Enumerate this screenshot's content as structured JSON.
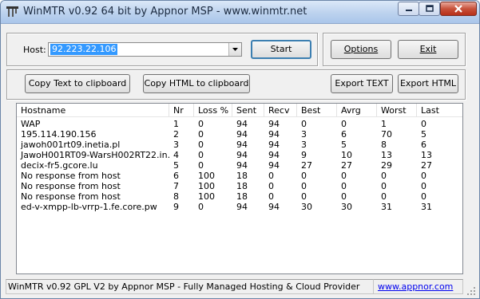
{
  "window": {
    "title": "WinMTR v0.92 64 bit by Appnor MSP - www.winmtr.net"
  },
  "host": {
    "label": "Host:",
    "value": "92.223.22.106"
  },
  "buttons": {
    "start": "Start",
    "options": "Options",
    "exit": "Exit",
    "copy_text": "Copy Text to clipboard",
    "copy_html": "Copy HTML to clipboard",
    "export_text": "Export TEXT",
    "export_html": "Export HTML"
  },
  "table": {
    "columns": [
      "Hostname",
      "Nr",
      "Loss %",
      "Sent",
      "Recv",
      "Best",
      "Avrg",
      "Worst",
      "Last"
    ],
    "rows": [
      [
        "WAP",
        "1",
        "0",
        "94",
        "94",
        "0",
        "0",
        "1",
        "0"
      ],
      [
        "195.114.190.156",
        "2",
        "0",
        "94",
        "94",
        "3",
        "6",
        "70",
        "5"
      ],
      [
        "jawoh001rt09.inetia.pl",
        "3",
        "0",
        "94",
        "94",
        "3",
        "5",
        "8",
        "6"
      ],
      [
        "JawoH001RT09-WarsH002RT22.in...",
        "4",
        "0",
        "94",
        "94",
        "9",
        "10",
        "13",
        "13"
      ],
      [
        "decix-fr5.gcore.lu",
        "5",
        "0",
        "94",
        "94",
        "27",
        "27",
        "29",
        "27"
      ],
      [
        "No response from host",
        "6",
        "100",
        "18",
        "0",
        "0",
        "0",
        "0",
        "0"
      ],
      [
        "No response from host",
        "7",
        "100",
        "18",
        "0",
        "0",
        "0",
        "0",
        "0"
      ],
      [
        "No response from host",
        "8",
        "100",
        "18",
        "0",
        "0",
        "0",
        "0",
        "0"
      ],
      [
        "ed-v-xmpp-lb-vrrp-1.fe.core.pw",
        "9",
        "0",
        "94",
        "94",
        "30",
        "30",
        "31",
        "31"
      ]
    ]
  },
  "status": {
    "text": "WinMTR v0.92 GPL V2 by Appnor MSP - Fully Managed Hosting & Cloud Provider",
    "link": "www.appnor.com"
  }
}
